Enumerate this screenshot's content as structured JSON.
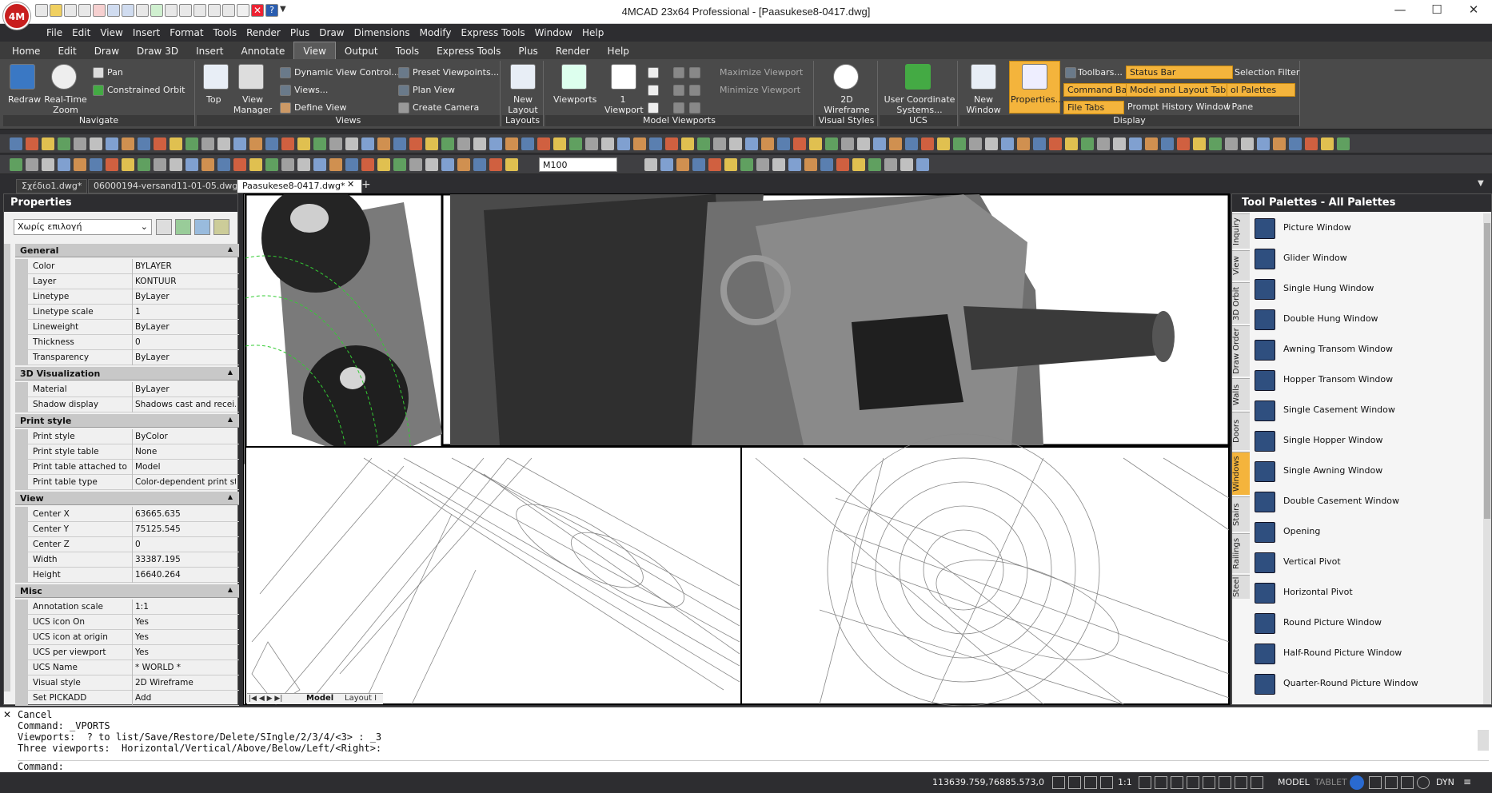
{
  "window": {
    "title": "4MCAD  23x64  Professional - [Paasukese8-0417.dwg]",
    "logo_text": "4M"
  },
  "menu": [
    "File",
    "Edit",
    "View",
    "Insert",
    "Format",
    "Tools",
    "Render",
    "Plus",
    "Draw",
    "Dimensions",
    "Modify",
    "Express Tools",
    "Window",
    "Help"
  ],
  "ribbon_tabs": [
    "Home",
    "Edit",
    "Draw",
    "Draw 3D",
    "Insert",
    "Annotate",
    "View",
    "Output",
    "Tools",
    "Express Tools",
    "Plus",
    "Render",
    "Help"
  ],
  "ribbon": {
    "navigate": {
      "label": "Navigate",
      "redraw": "Redraw",
      "realtime_zoom": "Real-Time Zoom",
      "pan": "Pan",
      "constrained_orbit": "Constrained Orbit"
    },
    "views": {
      "label": "Views",
      "top": "Top",
      "view_manager": "View Manager",
      "dynamic_view": "Dynamic View Control...",
      "views": "Views...",
      "define_view": "Define View",
      "preset_viewpoints": "Preset Viewpoints...",
      "plan_view": "Plan View",
      "create_camera": "Create Camera"
    },
    "layouts": {
      "label": "Layouts",
      "new_layout": "New Layout"
    },
    "model_viewports": {
      "label": "Model Viewports",
      "viewports": "Viewports",
      "one_viewport": "1 Viewport",
      "maximize": "Maximize Viewport",
      "minimize": "Minimize Viewport"
    },
    "visual_styles": {
      "label": "Visual Styles",
      "wireframe": "2D Wireframe"
    },
    "ucs": {
      "label": "UCS",
      "ucs_systems": "User Coordinate Systems..."
    },
    "display": {
      "label": "Display",
      "new_window": "New Window",
      "properties": "Properties...",
      "toolbars": "Toolbars...",
      "status_bar": "Status Bar",
      "selection_filter": "Selection Filter",
      "command_bar": "Command Bar",
      "model_layout_tabs": "Model and Layout Tabs",
      "tool_palettes": "ol Palettes",
      "file_tabs": "File Tabs",
      "prompt_history": "Prompt History Window",
      "pane": "l Pane"
    }
  },
  "toolbar": {
    "scale_value": "M100"
  },
  "doc_tabs": [
    "Σχέδιο1.dwg*",
    "06000194-versand11-01-05.dwg*",
    "Paasukese8-0417.dwg*"
  ],
  "properties": {
    "title": "Properties",
    "selection": "Χωρίς επιλογή",
    "sections": [
      {
        "name": "General",
        "rows": [
          [
            "Color",
            "BYLAYER"
          ],
          [
            "Layer",
            "KONTUUR"
          ],
          [
            "Linetype",
            "ByLayer"
          ],
          [
            "Linetype scale",
            "1"
          ],
          [
            "Lineweight",
            "ByLayer"
          ],
          [
            "Thickness",
            "0"
          ],
          [
            "Transparency",
            "ByLayer"
          ]
        ]
      },
      {
        "name": "3D Visualization",
        "rows": [
          [
            "Material",
            "ByLayer"
          ],
          [
            "Shadow display",
            "Shadows cast and recei..."
          ]
        ]
      },
      {
        "name": "Print style",
        "rows": [
          [
            "Print style",
            "ByColor"
          ],
          [
            "Print style table",
            "None"
          ],
          [
            "Print table attached to",
            "Model"
          ],
          [
            "Print table type",
            "Color-dependent print st..."
          ]
        ]
      },
      {
        "name": "View",
        "rows": [
          [
            "Center X",
            "63665.635"
          ],
          [
            "Center Y",
            "75125.545"
          ],
          [
            "Center Z",
            "0"
          ],
          [
            "Width",
            "33387.195"
          ],
          [
            "Height",
            "16640.264"
          ]
        ]
      },
      {
        "name": "Misc",
        "rows": [
          [
            "Annotation scale",
            "1:1"
          ],
          [
            "UCS icon On",
            "Yes"
          ],
          [
            "UCS icon at origin",
            "Yes"
          ],
          [
            "UCS per viewport",
            "Yes"
          ],
          [
            "UCS Name",
            "* WORLD *"
          ],
          [
            "Visual style",
            "2D Wireframe"
          ],
          [
            "Set PICKADD",
            "Add"
          ]
        ]
      }
    ]
  },
  "layout_tabs": [
    "Model",
    "Layout I"
  ],
  "palette": {
    "title": "Tool Palettes - All Palettes",
    "tabs": [
      "Inquiry",
      "View",
      "3D Orbit",
      "Draw Order",
      "Walls",
      "Doors",
      "Windows",
      "Stairs",
      "Railings",
      "Steel"
    ],
    "active_tab": "Windows",
    "items": [
      "Picture Window",
      "Glider Window",
      "Single Hung Window",
      "Double Hung Window",
      "Awning Transom Window",
      "Hopper Transom Window",
      "Single Casement Window",
      "Single Hopper Window",
      "Single Awning Window",
      "Double Casement Window",
      "Opening",
      "Vertical Pivot",
      "Horizontal Pivot",
      "Round Picture Window",
      "Half-Round Picture Window",
      "Quarter-Round Picture Window"
    ]
  },
  "command": {
    "lines": [
      "Cancel",
      "Command: _VPORTS",
      "Viewports:  ? to list/Save/Restore/Delete/SIngle/2/3/4/<3> : _3",
      "Three viewports:  Horizontal/Vertical/Above/Below/Left/<Right>:",
      "Command:"
    ]
  },
  "status": {
    "coords": "113639.759,76885.573,0",
    "scale": "1:1",
    "model": "MODEL",
    "tablet": "TABLET",
    "dyn": "DYN"
  },
  "colors": {
    "accent": "#f4b43c",
    "dark": "#2d2d30",
    "brand": "#c81e1e"
  }
}
